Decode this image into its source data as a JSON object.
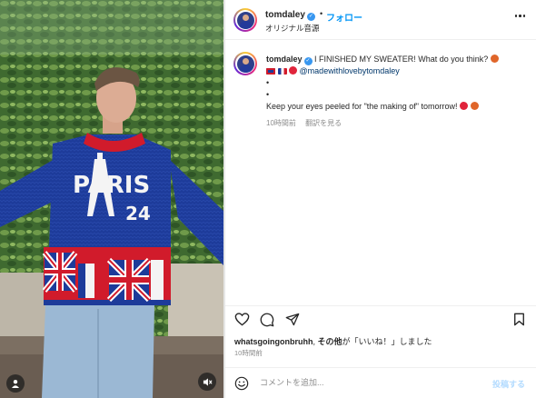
{
  "post": {
    "username": "tomdaley",
    "follow_label": "フォロー",
    "dot": "•",
    "audio_label": "オリジナル音源"
  },
  "caption": {
    "username": "tomdaley",
    "text_main": "I FINISHED MY SWEATER! What do you think?",
    "mention": "@madewithlovebytomdaley",
    "dot1": "•",
    "dot2": "•",
    "text_followup": "Keep your eyes peeled for \"the making of\" tomorrow!",
    "time_ago": "10時間前",
    "translate_label": "翻訳を見る"
  },
  "likes": {
    "user": "whatsgoingonbruhh",
    "others": "その他",
    "suffix": "が「いいね！」しました"
  },
  "post_time": "10時間前",
  "comment": {
    "placeholder": "コメントを追加...",
    "post_label": "投稿する"
  },
  "sweater": {
    "word": "PARIS",
    "number": "24"
  },
  "icons": {
    "more": "more-options-icon",
    "verified": "verified-badge-icon",
    "heart": "heart-icon",
    "comment": "comment-icon",
    "share": "share-icon",
    "bookmark": "bookmark-icon",
    "emoji": "emoji-icon",
    "user_tag": "user-tag-icon",
    "mute": "mute-icon"
  },
  "colors": {
    "accent": "#0095f6",
    "mention": "#00376b",
    "secondary_text": "#8e8e8e",
    "post_disabled": "#b3dbff"
  }
}
